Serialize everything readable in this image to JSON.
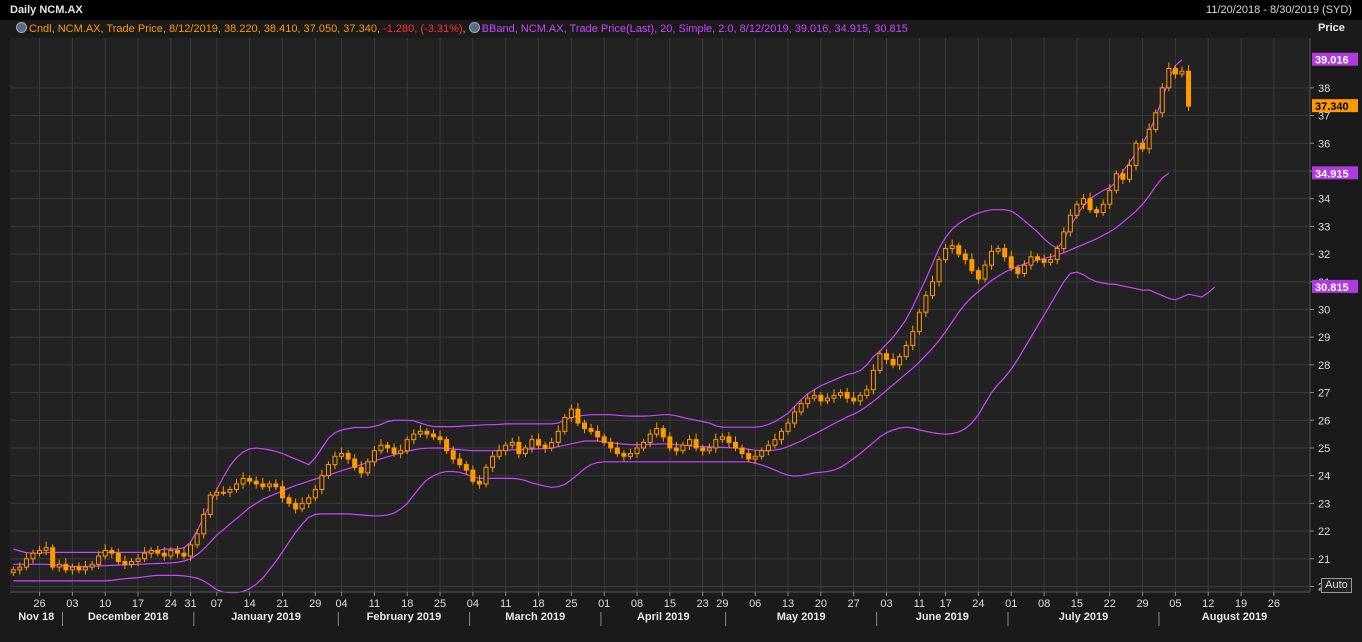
{
  "header": {
    "title": "Daily NCM.AX",
    "range": "11/20/2018 - 8/30/2019 (SYD)"
  },
  "legend": {
    "candle": {
      "prefix": "Cndl, NCM.AX, Trade Price, 8/12/2019, 38.220, 38.410, 37.050, 37.340, ",
      "change": "-1.280, (-3.31%)",
      "suffix": ","
    },
    "bband": "BBand, NCM.AX, Trade Price(Last),  20, Simple, 2.0,  8/12/2019, 39.016, 34.915, 30.815"
  },
  "axis": {
    "price_label": "Price",
    "auto_label": "Auto"
  },
  "tags": {
    "upper": "39.016",
    "last": "37.340",
    "middle": "34.915",
    "lower": "30.815"
  },
  "colors": {
    "candle": "#ff9900",
    "band": "#cc44ff",
    "last_tag_bg": "#ff9900",
    "band_tag_bg": "#b03adf",
    "background": "#1a1a1a",
    "grid": "#3a3a3a"
  },
  "chart_data": {
    "type": "candlestick",
    "ylim": [
      19.8,
      39.8
    ],
    "yticks": [
      20,
      21,
      22,
      23,
      24,
      25,
      26,
      27,
      28,
      29,
      30,
      31,
      32,
      33,
      34,
      35,
      36,
      37,
      38
    ],
    "date_ticks": [
      {
        "label": "26",
        "index": 4
      },
      {
        "label": "03",
        "index": 9
      },
      {
        "label": "10",
        "index": 14
      },
      {
        "label": "17",
        "index": 19
      },
      {
        "label": "24",
        "index": 24
      },
      {
        "label": "31",
        "index": 27
      },
      {
        "label": "07",
        "index": 31
      },
      {
        "label": "14",
        "index": 36
      },
      {
        "label": "21",
        "index": 41
      },
      {
        "label": "29",
        "index": 46
      },
      {
        "label": "04",
        "index": 50
      },
      {
        "label": "11",
        "index": 55
      },
      {
        "label": "18",
        "index": 60
      },
      {
        "label": "25",
        "index": 65
      },
      {
        "label": "04",
        "index": 70
      },
      {
        "label": "11",
        "index": 75
      },
      {
        "label": "18",
        "index": 80
      },
      {
        "label": "25",
        "index": 85
      },
      {
        "label": "01",
        "index": 90
      },
      {
        "label": "08",
        "index": 95
      },
      {
        "label": "15",
        "index": 100
      },
      {
        "label": "23",
        "index": 105
      },
      {
        "label": "29",
        "index": 108
      },
      {
        "label": "06",
        "index": 113
      },
      {
        "label": "13",
        "index": 118
      },
      {
        "label": "20",
        "index": 123
      },
      {
        "label": "27",
        "index": 128
      },
      {
        "label": "03",
        "index": 133
      },
      {
        "label": "11",
        "index": 138
      },
      {
        "label": "17",
        "index": 142
      },
      {
        "label": "24",
        "index": 147
      },
      {
        "label": "01",
        "index": 152
      },
      {
        "label": "08",
        "index": 157
      },
      {
        "label": "15",
        "index": 162
      },
      {
        "label": "22",
        "index": 167
      },
      {
        "label": "29",
        "index": 172
      },
      {
        "label": "05",
        "index": 177
      },
      {
        "label": "12",
        "index": 182
      },
      {
        "label": "19",
        "index": 187
      },
      {
        "label": "26",
        "index": 192
      }
    ],
    "months": [
      {
        "label": "Nov 18",
        "start": 0,
        "end": 7
      },
      {
        "label": "December 2018",
        "start": 8,
        "end": 27
      },
      {
        "label": "January 2019",
        "start": 28,
        "end": 49
      },
      {
        "label": "February 2019",
        "start": 50,
        "end": 69
      },
      {
        "label": "March 2019",
        "start": 70,
        "end": 89
      },
      {
        "label": "April 2019",
        "start": 90,
        "end": 108
      },
      {
        "label": "May 2019",
        "start": 109,
        "end": 131
      },
      {
        "label": "June 2019",
        "start": 132,
        "end": 151
      },
      {
        "label": "July 2019",
        "start": 152,
        "end": 174
      },
      {
        "label": "August 2019",
        "start": 175,
        "end": 197
      }
    ],
    "series": [
      {
        "name": "Cndl, NCM.AX",
        "kind": "candle",
        "close": [
          20.6,
          20.7,
          21.0,
          21.2,
          21.3,
          21.4,
          20.7,
          20.8,
          20.6,
          20.7,
          20.6,
          20.7,
          20.8,
          21.1,
          21.3,
          21.2,
          20.9,
          20.8,
          20.9,
          21.0,
          21.2,
          21.3,
          21.2,
          21.1,
          21.3,
          21.2,
          21.1,
          21.5,
          21.9,
          22.6,
          23.3,
          23.4,
          23.4,
          23.5,
          23.7,
          23.9,
          23.8,
          23.7,
          23.6,
          23.7,
          23.6,
          23.2,
          23.0,
          22.8,
          23.0,
          23.2,
          23.5,
          24.0,
          24.4,
          24.7,
          24.8,
          24.6,
          24.3,
          24.1,
          24.5,
          24.9,
          25.1,
          25.0,
          24.8,
          24.9,
          25.3,
          25.5,
          25.6,
          25.5,
          25.4,
          25.3,
          24.9,
          24.6,
          24.4,
          24.2,
          23.8,
          23.7,
          24.3,
          24.7,
          24.9,
          25.1,
          25.2,
          24.8,
          25.0,
          25.3,
          25.1,
          25.0,
          25.2,
          25.6,
          26.1,
          26.4,
          25.9,
          25.7,
          25.6,
          25.4,
          25.2,
          25.0,
          24.8,
          24.7,
          24.8,
          25.0,
          25.2,
          25.5,
          25.7,
          25.4,
          25.0,
          24.9,
          25.1,
          25.3,
          25.0,
          24.9,
          25.0,
          25.3,
          25.4,
          25.2,
          25.0,
          24.8,
          24.6,
          24.7,
          24.9,
          25.1,
          25.3,
          25.6,
          25.9,
          26.3,
          26.6,
          26.8,
          26.9,
          26.7,
          26.8,
          26.9,
          27.0,
          26.8,
          26.7,
          26.9,
          27.1,
          27.8,
          28.4,
          28.2,
          28.0,
          28.3,
          28.7,
          29.2,
          29.9,
          30.5,
          31.0,
          31.8,
          32.2,
          32.3,
          32.0,
          31.8,
          31.4,
          31.1,
          31.6,
          32.1,
          32.2,
          31.9,
          31.5,
          31.3,
          31.6,
          31.9,
          31.8,
          31.7,
          31.8,
          32.2,
          32.8,
          33.4,
          33.8,
          34.0,
          33.6,
          33.5,
          33.8,
          34.3,
          34.9,
          34.7,
          35.2,
          36.0,
          35.8,
          36.5,
          37.1,
          38.0,
          38.7,
          38.5,
          38.6,
          37.34
        ]
      },
      {
        "name": "BBand, upper",
        "kind": "band",
        "values": [
          21.35,
          21.28,
          21.22,
          21.2,
          21.2,
          21.22,
          21.23,
          21.23,
          21.23,
          21.23,
          21.23,
          21.23,
          21.23,
          21.23,
          21.23,
          21.23,
          21.23,
          21.23,
          21.23,
          21.23,
          21.23,
          21.26,
          21.3,
          21.35,
          21.35,
          21.35,
          21.4,
          21.6,
          22.0,
          22.5,
          23.0,
          23.5,
          23.95,
          24.35,
          24.65,
          24.85,
          24.97,
          25.0,
          24.97,
          24.93,
          24.88,
          24.8,
          24.7,
          24.6,
          24.5,
          24.4,
          24.65,
          25.0,
          25.35,
          25.55,
          25.65,
          25.7,
          25.74,
          25.74,
          25.74,
          25.78,
          25.85,
          25.95,
          26.0,
          26.0,
          26.0,
          25.98,
          25.9,
          25.82,
          25.77,
          25.77,
          25.77,
          25.77,
          25.78,
          25.8,
          25.81,
          25.82,
          25.84,
          25.84,
          25.85,
          25.87,
          25.87,
          25.87,
          25.87,
          25.87,
          25.87,
          25.87,
          25.87,
          25.9,
          26.0,
          26.1,
          26.15,
          26.18,
          26.2,
          26.2,
          26.2,
          26.2,
          26.18,
          26.16,
          26.15,
          26.15,
          26.15,
          26.16,
          26.18,
          26.2,
          26.2,
          26.16,
          26.1,
          26.05,
          26.0,
          25.95,
          25.9,
          25.8,
          25.75,
          25.75,
          25.75,
          25.75,
          25.75,
          25.75,
          25.78,
          25.85,
          25.95,
          26.1,
          26.25,
          26.5,
          26.75,
          26.95,
          27.1,
          27.25,
          27.35,
          27.45,
          27.55,
          27.65,
          27.7,
          27.8,
          28.0,
          28.3,
          28.5,
          28.75,
          29.0,
          29.3,
          29.65,
          30.1,
          30.6,
          31.1,
          31.65,
          32.2,
          32.6,
          32.9,
          33.1,
          33.25,
          33.38,
          33.48,
          33.55,
          33.6,
          33.6,
          33.6,
          33.55,
          33.4,
          33.2,
          33.0,
          32.8,
          32.55,
          32.35,
          32.2,
          32.5,
          33.0,
          33.4,
          33.75,
          34.0,
          34.15,
          34.3,
          34.4,
          34.6,
          35.0,
          35.3,
          35.65,
          36.0,
          36.4,
          36.95,
          37.6,
          38.3,
          38.8,
          39.016
        ]
      },
      {
        "name": "BBand, middle",
        "kind": "band",
        "values": [
          20.8,
          20.8,
          20.8,
          20.8,
          20.8,
          20.8,
          20.78,
          20.76,
          20.74,
          20.72,
          20.72,
          20.72,
          20.73,
          20.74,
          20.75,
          20.76,
          20.77,
          20.78,
          20.79,
          20.8,
          20.81,
          20.82,
          20.83,
          20.84,
          20.85,
          20.87,
          20.92,
          21.0,
          21.15,
          21.35,
          21.6,
          21.85,
          22.05,
          22.25,
          22.45,
          22.65,
          22.85,
          23.0,
          23.15,
          23.25,
          23.35,
          23.45,
          23.55,
          23.65,
          23.72,
          23.8,
          23.88,
          23.95,
          24.03,
          24.1,
          24.18,
          24.25,
          24.32,
          24.4,
          24.47,
          24.54,
          24.61,
          24.68,
          24.75,
          24.82,
          24.88,
          24.93,
          24.97,
          24.99,
          25.0,
          25.0,
          24.98,
          24.96,
          24.94,
          24.92,
          24.9,
          24.9,
          24.9,
          24.9,
          24.91,
          24.92,
          24.93,
          24.94,
          24.95,
          24.96,
          24.97,
          24.98,
          24.99,
          25.05,
          25.1,
          25.15,
          25.2,
          25.25,
          25.25,
          25.25,
          25.22,
          25.19,
          25.16,
          25.14,
          25.12,
          25.12,
          25.12,
          25.13,
          25.14,
          25.15,
          25.14,
          25.12,
          25.1,
          25.08,
          25.06,
          25.05,
          25.04,
          25.03,
          25.02,
          25.01,
          25.0,
          24.98,
          24.95,
          24.92,
          24.9,
          24.9,
          24.92,
          24.97,
          25.05,
          25.15,
          25.25,
          25.38,
          25.5,
          25.62,
          25.75,
          25.88,
          26.0,
          26.12,
          26.22,
          26.35,
          26.5,
          26.68,
          26.88,
          27.08,
          27.28,
          27.48,
          27.68,
          27.88,
          28.1,
          28.35,
          28.6,
          28.88,
          29.2,
          29.55,
          29.9,
          30.2,
          30.45,
          30.65,
          30.85,
          31.05,
          31.2,
          31.35,
          31.45,
          31.55,
          31.65,
          31.72,
          31.78,
          31.84,
          31.9,
          31.97,
          32.05,
          32.15,
          32.25,
          32.35,
          32.45,
          32.55,
          32.68,
          32.8,
          32.95,
          33.15,
          33.35,
          33.55,
          33.8,
          34.1,
          34.45,
          34.75,
          34.915
        ]
      },
      {
        "name": "BBand, lower",
        "kind": "band",
        "values": [
          20.2,
          20.2,
          20.2,
          20.2,
          20.2,
          20.2,
          20.2,
          20.2,
          20.2,
          20.2,
          20.2,
          20.2,
          20.2,
          20.2,
          20.2,
          20.22,
          20.25,
          20.28,
          20.3,
          20.32,
          20.35,
          20.38,
          20.4,
          20.4,
          20.4,
          20.4,
          20.38,
          20.35,
          20.3,
          20.2,
          20.05,
          19.88,
          19.8,
          19.78,
          19.78,
          19.82,
          19.92,
          20.08,
          20.3,
          20.6,
          20.9,
          21.25,
          21.6,
          21.95,
          22.25,
          22.5,
          22.6,
          22.62,
          22.62,
          22.62,
          22.62,
          22.62,
          22.6,
          22.58,
          22.56,
          22.55,
          22.55,
          22.58,
          22.65,
          22.8,
          23.0,
          23.3,
          23.6,
          23.85,
          24.0,
          24.1,
          24.15,
          24.15,
          24.12,
          24.05,
          23.95,
          23.9,
          23.9,
          23.9,
          23.9,
          23.9,
          23.9,
          23.88,
          23.82,
          23.74,
          23.68,
          23.62,
          23.58,
          23.6,
          23.68,
          23.85,
          24.05,
          24.25,
          24.4,
          24.47,
          24.5,
          24.5,
          24.5,
          24.5,
          24.5,
          24.5,
          24.5,
          24.5,
          24.5,
          24.5,
          24.5,
          24.5,
          24.5,
          24.5,
          24.5,
          24.5,
          24.5,
          24.5,
          24.5,
          24.5,
          24.5,
          24.5,
          24.5,
          24.45,
          24.38,
          24.3,
          24.2,
          24.1,
          24.02,
          23.98,
          24.0,
          24.05,
          24.1,
          24.12,
          24.15,
          24.2,
          24.3,
          24.45,
          24.62,
          24.8,
          25.0,
          25.2,
          25.4,
          25.55,
          25.65,
          25.72,
          25.75,
          25.72,
          25.65,
          25.6,
          25.55,
          25.52,
          25.5,
          25.52,
          25.58,
          25.7,
          25.9,
          26.2,
          26.6,
          27.0,
          27.3,
          27.55,
          27.85,
          28.2,
          28.6,
          29.0,
          29.4,
          29.8,
          30.2,
          30.6,
          31.0,
          31.3,
          31.35,
          31.25,
          31.1,
          31.0,
          30.95,
          30.92,
          30.9,
          30.85,
          30.8,
          30.75,
          30.7,
          30.7,
          30.6,
          30.5,
          30.4,
          30.35,
          30.45,
          30.55,
          30.5,
          30.45,
          30.6,
          30.815
        ]
      }
    ]
  }
}
